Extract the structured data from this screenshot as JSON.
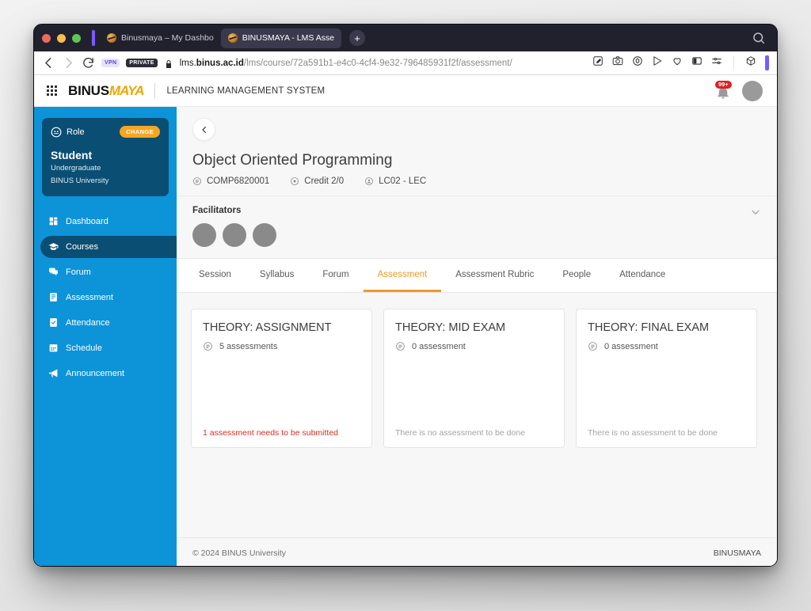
{
  "browser": {
    "tabs": [
      {
        "title": "Binusmaya – My Dashbo",
        "active": false
      },
      {
        "title": "BINUSMAYA - LMS Asse",
        "active": true
      }
    ],
    "new_tab_label": "+",
    "tabstrip_search_icon": "search-icon",
    "toolbar": {
      "back_icon": "back-arrow-icon",
      "forward_icon": "forward-arrow-icon",
      "reload_icon": "reload-icon",
      "vpn_badge": "VPN",
      "private_badge": "PRIVATE",
      "lock_icon": "lock-icon",
      "url_host": "lms.binus.ac.id",
      "url_host_bold": "binus.ac.id",
      "url_path": "/lms/course/72a591b1-e4c0-4cf4-9e32-796485931f2f/assessment/",
      "icons": [
        "edit-icon",
        "camera-icon",
        "shield-icon",
        "send-icon",
        "heart-icon",
        "reader-mode-icon",
        "settings-sliders-icon",
        "extension-icon"
      ]
    }
  },
  "appbar": {
    "grid_icon": "apps-grid-icon",
    "logo_primary": "BINUS",
    "logo_secondary": "MAYA",
    "subtitle": "LEARNING MANAGEMENT SYSTEM",
    "notification_badge": "99+",
    "bell_icon": "bell-icon",
    "avatar": "user-avatar"
  },
  "sidebar": {
    "role": {
      "label": "Role",
      "change_label": "CHANGE",
      "name": "Student",
      "level": "Undergraduate",
      "institution": "BINUS University",
      "icon": "role-face-icon"
    },
    "items": [
      {
        "label": "Dashboard",
        "icon": "dashboard-icon",
        "active": false
      },
      {
        "label": "Courses",
        "icon": "graduation-cap-icon",
        "active": true
      },
      {
        "label": "Forum",
        "icon": "forum-icon",
        "active": false
      },
      {
        "label": "Assessment",
        "icon": "assessment-icon",
        "active": false
      },
      {
        "label": "Attendance",
        "icon": "attendance-icon",
        "active": false
      },
      {
        "label": "Schedule",
        "icon": "calendar-icon",
        "active": false
      },
      {
        "label": "Announcement",
        "icon": "megaphone-icon",
        "active": false
      }
    ]
  },
  "course": {
    "back_icon": "chevron-left-icon",
    "title": "Object Oriented Programming",
    "meta": [
      {
        "label": "COMP6820001",
        "icon": "course-code-icon"
      },
      {
        "label": "Credit 2/0",
        "icon": "credit-icon"
      },
      {
        "label": "LC02 - LEC",
        "icon": "class-icon"
      }
    ]
  },
  "facilitators": {
    "title": "Facilitators",
    "count": 3,
    "chevron_icon": "chevron-down-icon"
  },
  "tabs": [
    {
      "label": "Session",
      "active": false
    },
    {
      "label": "Syllabus",
      "active": false
    },
    {
      "label": "Forum",
      "active": false
    },
    {
      "label": "Assessment",
      "active": true
    },
    {
      "label": "Assessment Rubric",
      "active": false
    },
    {
      "label": "People",
      "active": false
    },
    {
      "label": "Attendance",
      "active": false
    }
  ],
  "cards": [
    {
      "title": "THEORY: ASSIGNMENT",
      "count_label": "5 assessments",
      "count_icon": "list-circle-icon",
      "status": "1 assessment needs to be submitted",
      "status_type": "warn"
    },
    {
      "title": "THEORY: MID EXAM",
      "count_label": "0 assessment",
      "count_icon": "list-circle-icon",
      "status": "There is no assessment to be done",
      "status_type": "muted"
    },
    {
      "title": "THEORY: FINAL EXAM",
      "count_label": "0 assessment",
      "count_icon": "list-circle-icon",
      "status": "There is no assessment to be done",
      "status_type": "muted"
    }
  ],
  "footer": {
    "copyright": "© 2024 BINUS University",
    "brand": "BINUSMAYA"
  },
  "colors": {
    "sidebar_blue": "#0d93d8",
    "sidebar_dark": "#0a4e73",
    "accent_orange": "#ef9a28",
    "badge_orange": "#f5a623",
    "warn_red": "#d93025",
    "notification_red": "#e02020"
  }
}
